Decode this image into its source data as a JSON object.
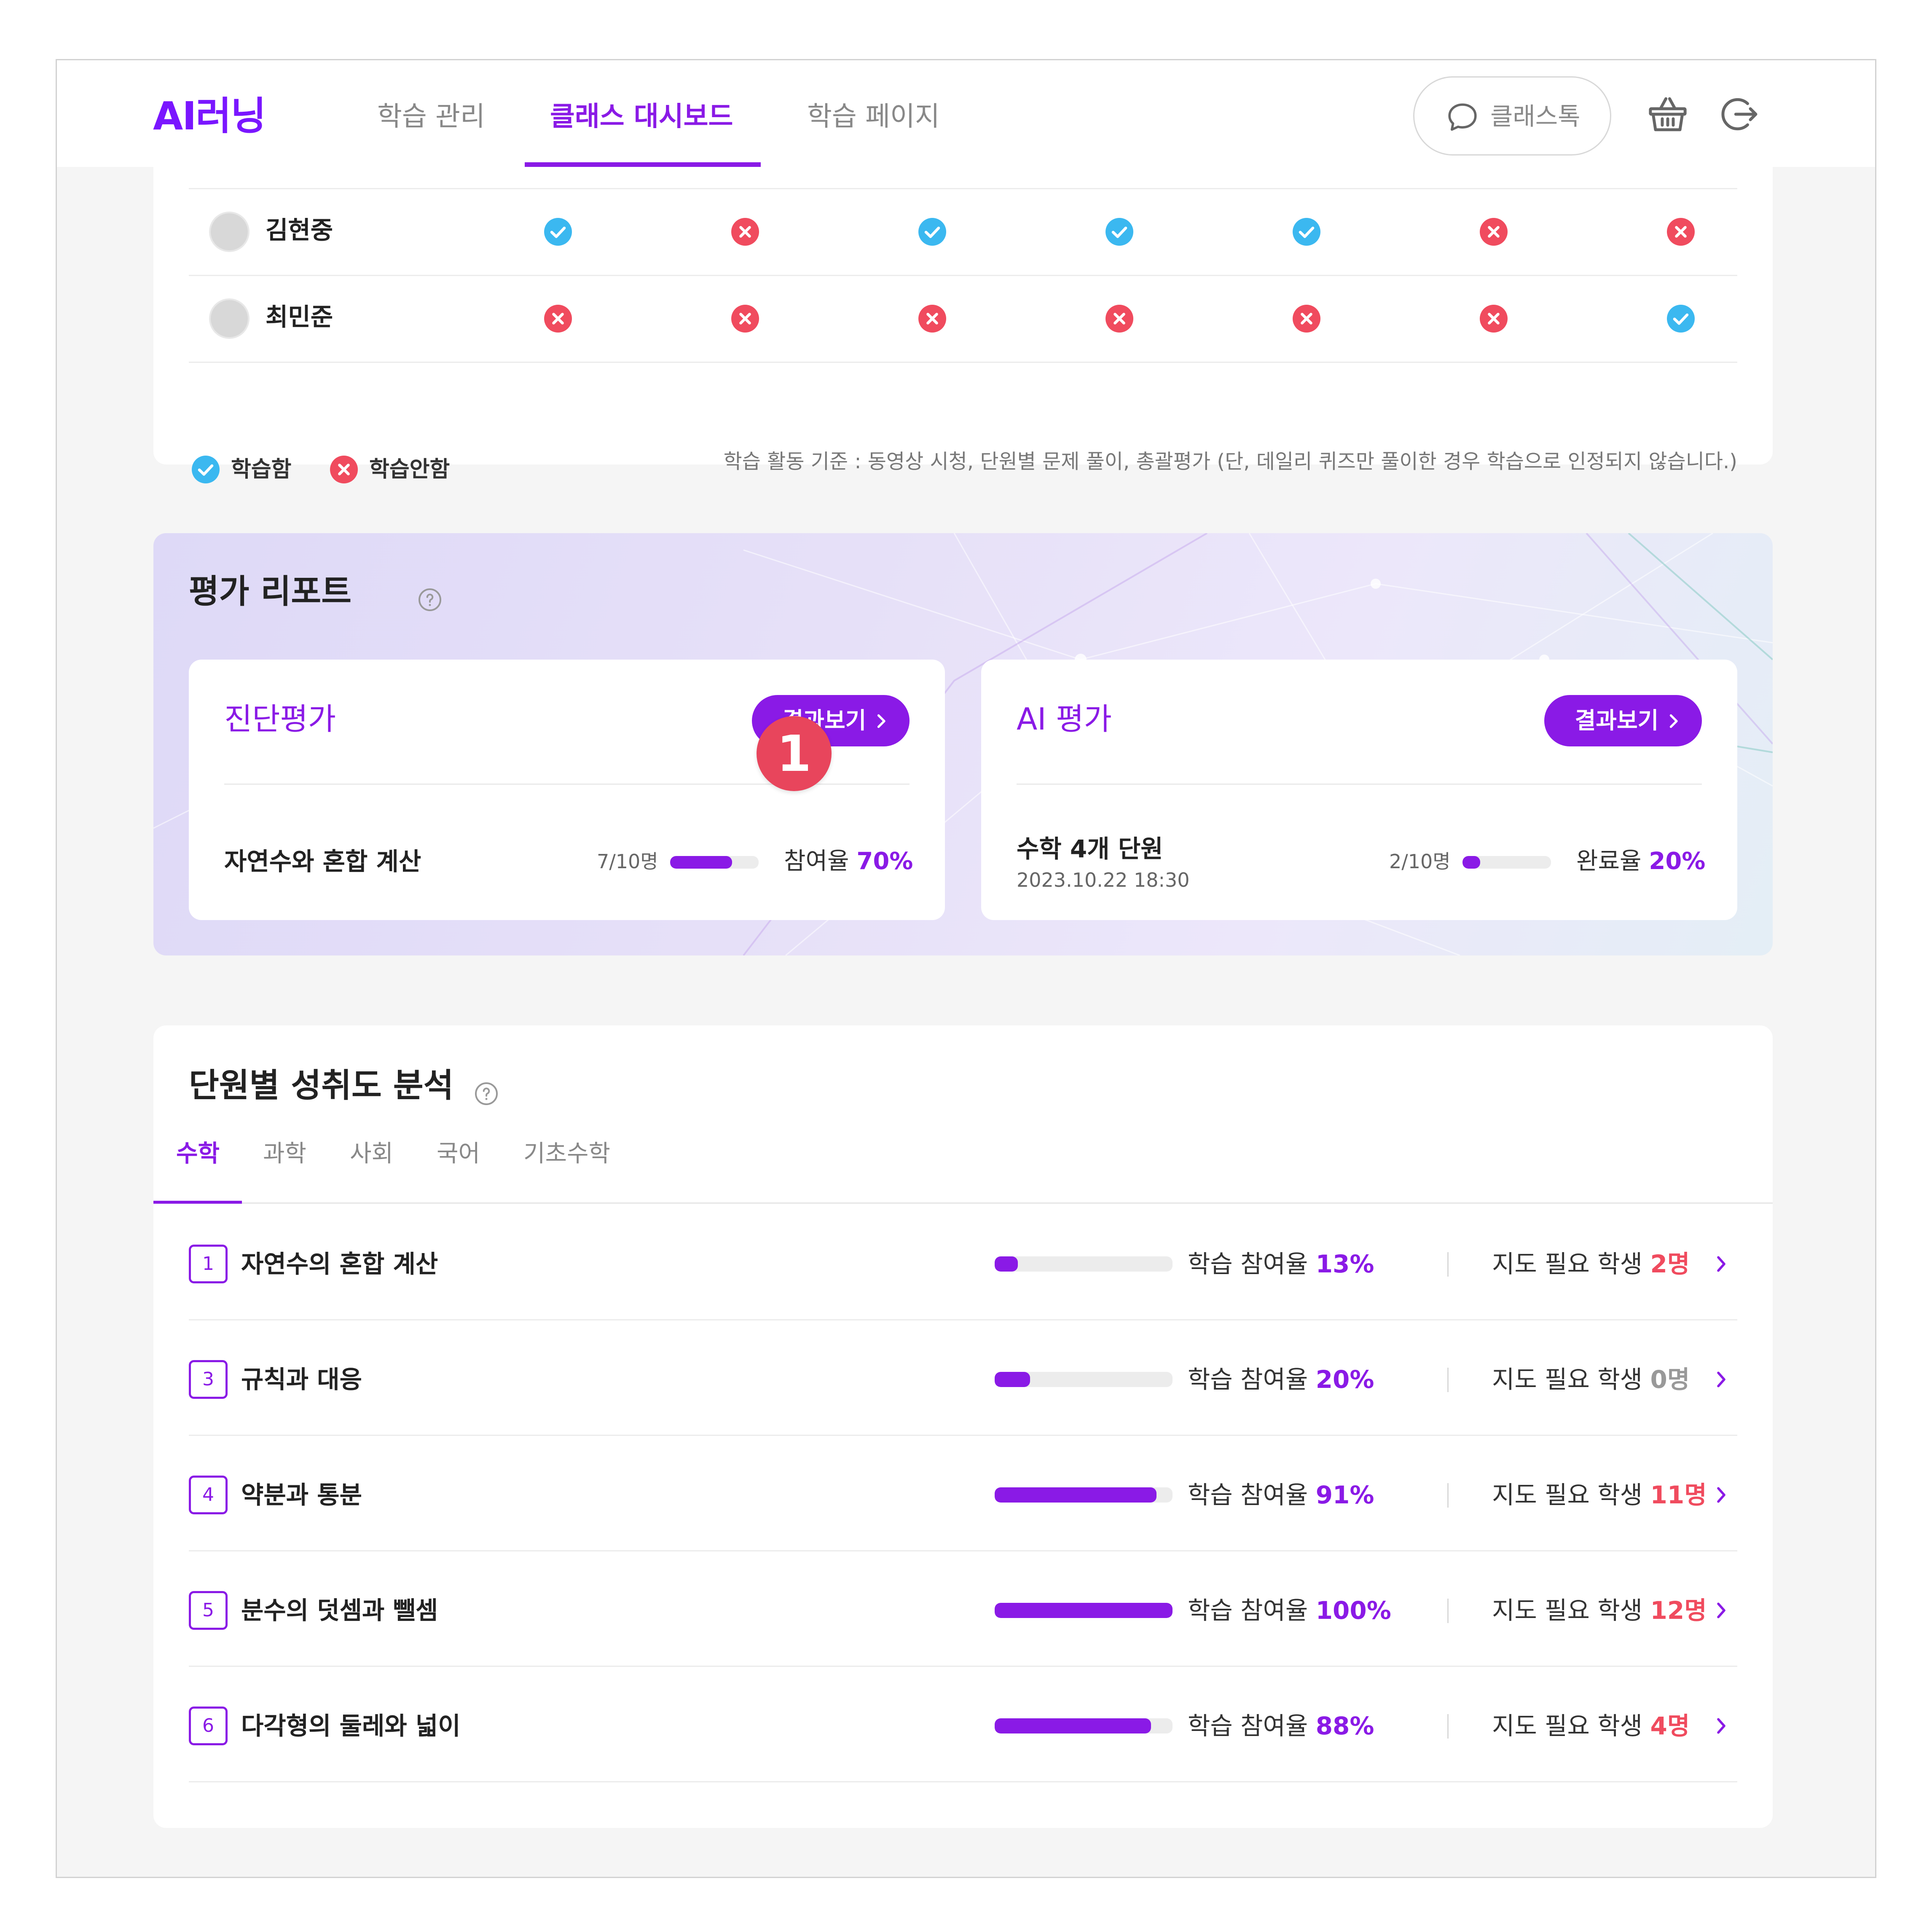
{
  "header": {
    "logo": "AI러닝",
    "nav": [
      "학습 관리",
      "클래스 대시보드",
      "학습 페이지"
    ],
    "active_nav": "클래스 대시보드",
    "chat_label": "클래스톡"
  },
  "attendance": {
    "students": [
      {
        "name": "김현중",
        "marks": [
          true,
          false,
          true,
          true,
          true,
          false,
          false
        ]
      },
      {
        "name": "최민준",
        "marks": [
          false,
          false,
          false,
          false,
          false,
          false,
          true
        ]
      }
    ],
    "legend_ok": "학습함",
    "legend_no": "학습안함",
    "criteria": "학습 활동 기준 : 동영상 시청, 단원별 문제 풀이, 총괄평가 (단, 데일리 퀴즈만 풀이한 경우 학습으로 인정되지 않습니다.)"
  },
  "eval_report": {
    "title": "평가 리포트",
    "badge": "1",
    "cards": [
      {
        "title": "진단평가",
        "button": "결과보기",
        "subject": "자연수와 혼합 계산",
        "date": "",
        "count": "7/10명",
        "progress": 0.7,
        "rate_label": "참여율",
        "rate_value": "70%"
      },
      {
        "title": "AI 평가",
        "button": "결과보기",
        "subject": "수학 4개 단원",
        "date": "2023.10.22 18:30",
        "count": "2/10명",
        "progress": 0.2,
        "rate_label": "완료율",
        "rate_value": "20%"
      }
    ]
  },
  "achievement": {
    "title": "단원별 성취도 분석",
    "tabs": [
      "수학",
      "과학",
      "사회",
      "국어",
      "기초수학"
    ],
    "active_tab": "수학",
    "participation_label": "학습 참여율",
    "guide_label": "지도 필요 학생",
    "units": [
      {
        "num": "1",
        "name": "자연수의 혼합 계산",
        "rate": "13%",
        "progress": 0.13,
        "need": "2명"
      },
      {
        "num": "3",
        "name": "규칙과 대응",
        "rate": "20%",
        "progress": 0.2,
        "need": "0명"
      },
      {
        "num": "4",
        "name": "약분과 통분",
        "rate": "91%",
        "progress": 0.91,
        "need": "11명"
      },
      {
        "num": "5",
        "name": "분수의 덧셈과 뺄셈",
        "rate": "100%",
        "progress": 1.0,
        "need": "12명"
      },
      {
        "num": "6",
        "name": "다각형의 둘레와 넓이",
        "rate": "88%",
        "progress": 0.88,
        "need": "4명"
      }
    ]
  },
  "colors": {
    "accent": "#8a1ae6",
    "ok": "#3bb8f0",
    "no": "#f04b5e",
    "badge": "#e8455c"
  }
}
